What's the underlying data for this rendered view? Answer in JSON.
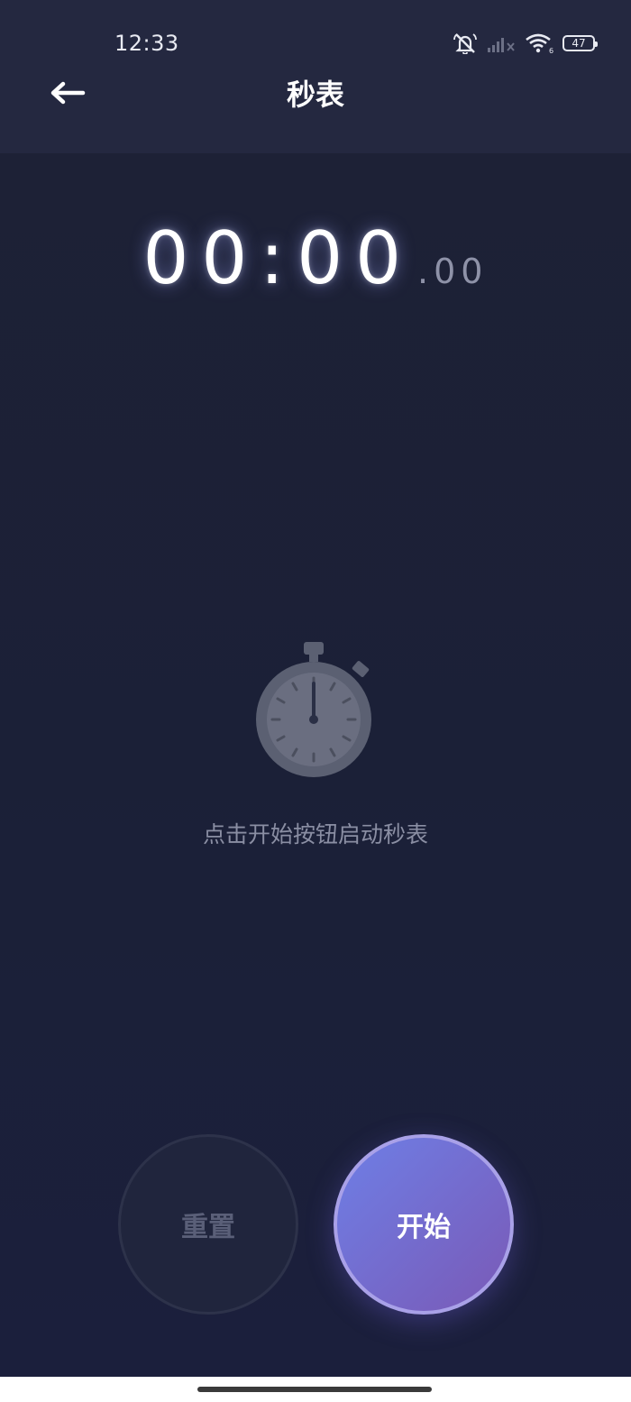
{
  "status_bar": {
    "time": "12:33",
    "battery": "47"
  },
  "header": {
    "title": "秒表"
  },
  "timer": {
    "main": "00:00",
    "fraction": ".00"
  },
  "empty_state": {
    "hint": "点击开始按钮启动秒表"
  },
  "controls": {
    "reset_label": "重置",
    "start_label": "开始"
  },
  "colors": {
    "background": "#1c2138",
    "header": "#242840",
    "accent_start": "#6e7fe6",
    "accent_end": "#7a59b6"
  },
  "icons": {
    "back": "arrow-left-icon",
    "stopwatch": "stopwatch-icon",
    "mute": "bell-muted-icon",
    "signal": "signal-icon",
    "wifi": "wifi-icon",
    "battery": "battery-icon"
  }
}
